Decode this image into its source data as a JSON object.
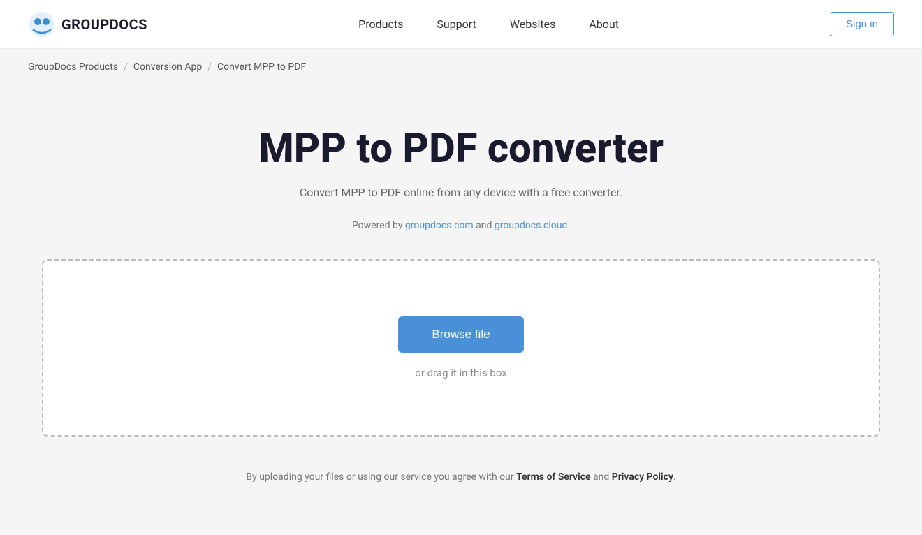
{
  "navbar": {
    "logo_text": "GROUPDOCS",
    "nav_items": [
      {
        "label": "Products",
        "id": "products"
      },
      {
        "label": "Support",
        "id": "support"
      },
      {
        "label": "Websites",
        "id": "websites"
      },
      {
        "label": "About",
        "id": "about"
      }
    ],
    "sign_in_label": "Sign in"
  },
  "breadcrumb": {
    "items": [
      {
        "label": "GroupDocs Products",
        "id": "groupdocs-products"
      },
      {
        "label": "Conversion App",
        "id": "conversion-app"
      },
      {
        "label": "Convert MPP to PDF",
        "id": "current"
      }
    ],
    "separator": "/"
  },
  "main": {
    "title": "MPP to PDF converter",
    "subtitle": "Convert MPP to PDF online from any device with a free converter.",
    "powered_by_prefix": "Powered by ",
    "powered_by_link1": "groupdocs.com",
    "powered_by_and": " and ",
    "powered_by_link2": "groupdocs.cloud",
    "powered_by_suffix": ".",
    "browse_button_label": "Browse file",
    "drag_text": "or drag it in this box"
  },
  "footer": {
    "text_prefix": "By uploading your files or using our service you agree with our ",
    "terms_label": "Terms of Service",
    "and_text": " and ",
    "privacy_label": "Privacy Policy",
    "text_suffix": "."
  }
}
